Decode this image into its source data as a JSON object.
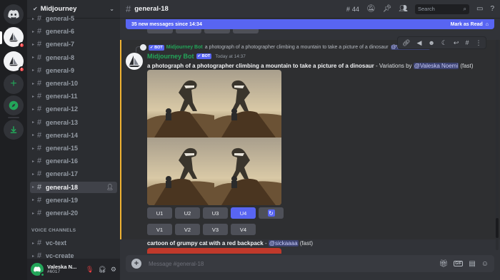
{
  "server": {
    "name": "Midjourney"
  },
  "channels": [
    {
      "name": "general-5",
      "active": false
    },
    {
      "name": "general-6",
      "active": false
    },
    {
      "name": "general-7",
      "active": false
    },
    {
      "name": "general-8",
      "active": false
    },
    {
      "name": "general-9",
      "active": false
    },
    {
      "name": "general-10",
      "active": false
    },
    {
      "name": "general-11",
      "active": false
    },
    {
      "name": "general-12",
      "active": false
    },
    {
      "name": "general-13",
      "active": false
    },
    {
      "name": "general-14",
      "active": false
    },
    {
      "name": "general-15",
      "active": false
    },
    {
      "name": "general-16",
      "active": false
    },
    {
      "name": "general-17",
      "active": false
    },
    {
      "name": "general-18",
      "active": true
    },
    {
      "name": "general-19",
      "active": false
    },
    {
      "name": "general-20",
      "active": false
    }
  ],
  "voice_section": "VOICE CHANNELS",
  "voice_channels": [
    {
      "name": "vc-text"
    },
    {
      "name": "vc-create"
    }
  ],
  "user": {
    "name": "Valeska N...",
    "tag": "#6017"
  },
  "topbar": {
    "channel": "general-18",
    "threads_count": "44",
    "search_placeholder": "Search"
  },
  "new_messages": {
    "text": "35 new messages since 14:34",
    "mark_read": "Mark as Read"
  },
  "reply": {
    "bot_tag": "BOT",
    "author": "Midjourney Bot",
    "text": "a photograph of a photographer climbing a mountain to take a picture of a dinosaur"
  },
  "message": {
    "author": "Midjourney Bot",
    "bot_tag": "BOT",
    "time": "Today at 14:37",
    "prompt": "a photograph of a photographer climbing a mountain to take a picture of a dinosaur",
    "suffix": " - Variations by ",
    "mention": "@Valeska Noemi",
    "mode": " (fast)"
  },
  "upscale_buttons": [
    "U1",
    "U2",
    "U3",
    "U4"
  ],
  "variation_buttons": [
    "V1",
    "V2",
    "V3",
    "V4"
  ],
  "next_message": {
    "prompt": "cartoon of grumpy cat with a red backpack",
    "sep": " - ",
    "mention": "@sickaaaa",
    "mode": " (fast)"
  },
  "composer": {
    "placeholder": "Message #general-18"
  },
  "colors": {
    "accent": "#5865f2",
    "bot_name": "#23a559",
    "highlight_bar": "#f0b232",
    "danger": "#f23f42"
  }
}
